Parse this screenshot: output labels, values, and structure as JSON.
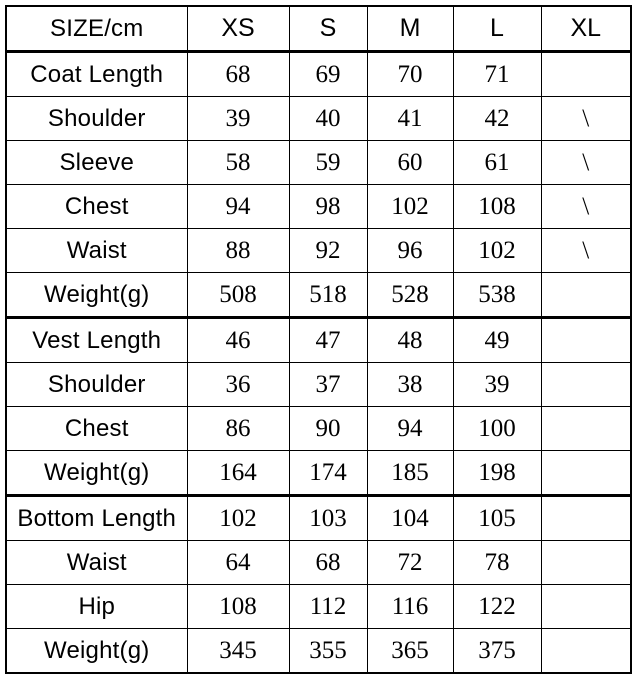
{
  "table": {
    "columns": [
      "SIZE/cm",
      "XS",
      "S",
      "M",
      "L",
      "XL"
    ],
    "na_marker": "\\",
    "sections": [
      {
        "name": "coat",
        "rows": [
          {
            "label": "Coat Length",
            "values": [
              "68",
              "69",
              "70",
              "71",
              ""
            ]
          },
          {
            "label": "Shoulder",
            "values": [
              "39",
              "40",
              "41",
              "42",
              "\\"
            ]
          },
          {
            "label": "Sleeve",
            "values": [
              "58",
              "59",
              "60",
              "61",
              "\\"
            ]
          },
          {
            "label": "Chest",
            "values": [
              "94",
              "98",
              "102",
              "108",
              "\\"
            ]
          },
          {
            "label": "Waist",
            "values": [
              "88",
              "92",
              "96",
              "102",
              "\\"
            ]
          },
          {
            "label": "Weight(g)",
            "values": [
              "508",
              "518",
              "528",
              "538",
              ""
            ]
          }
        ]
      },
      {
        "name": "vest",
        "rows": [
          {
            "label": "Vest Length",
            "values": [
              "46",
              "47",
              "48",
              "49",
              ""
            ]
          },
          {
            "label": "Shoulder",
            "values": [
              "36",
              "37",
              "38",
              "39",
              ""
            ]
          },
          {
            "label": "Chest",
            "values": [
              "86",
              "90",
              "94",
              "100",
              ""
            ]
          },
          {
            "label": "Weight(g)",
            "values": [
              "164",
              "174",
              "185",
              "198",
              ""
            ]
          }
        ]
      },
      {
        "name": "bottom",
        "rows": [
          {
            "label": "Bottom Length",
            "values": [
              "102",
              "103",
              "104",
              "105",
              ""
            ]
          },
          {
            "label": "Waist",
            "values": [
              "64",
              "68",
              "72",
              "78",
              ""
            ]
          },
          {
            "label": "Hip",
            "values": [
              "108",
              "112",
              "116",
              "122",
              ""
            ]
          },
          {
            "label": "Weight(g)",
            "values": [
              "345",
              "355",
              "365",
              "375",
              ""
            ]
          }
        ]
      }
    ]
  },
  "colors": {
    "border": "#000000",
    "text": "#000000",
    "background": "#ffffff"
  }
}
